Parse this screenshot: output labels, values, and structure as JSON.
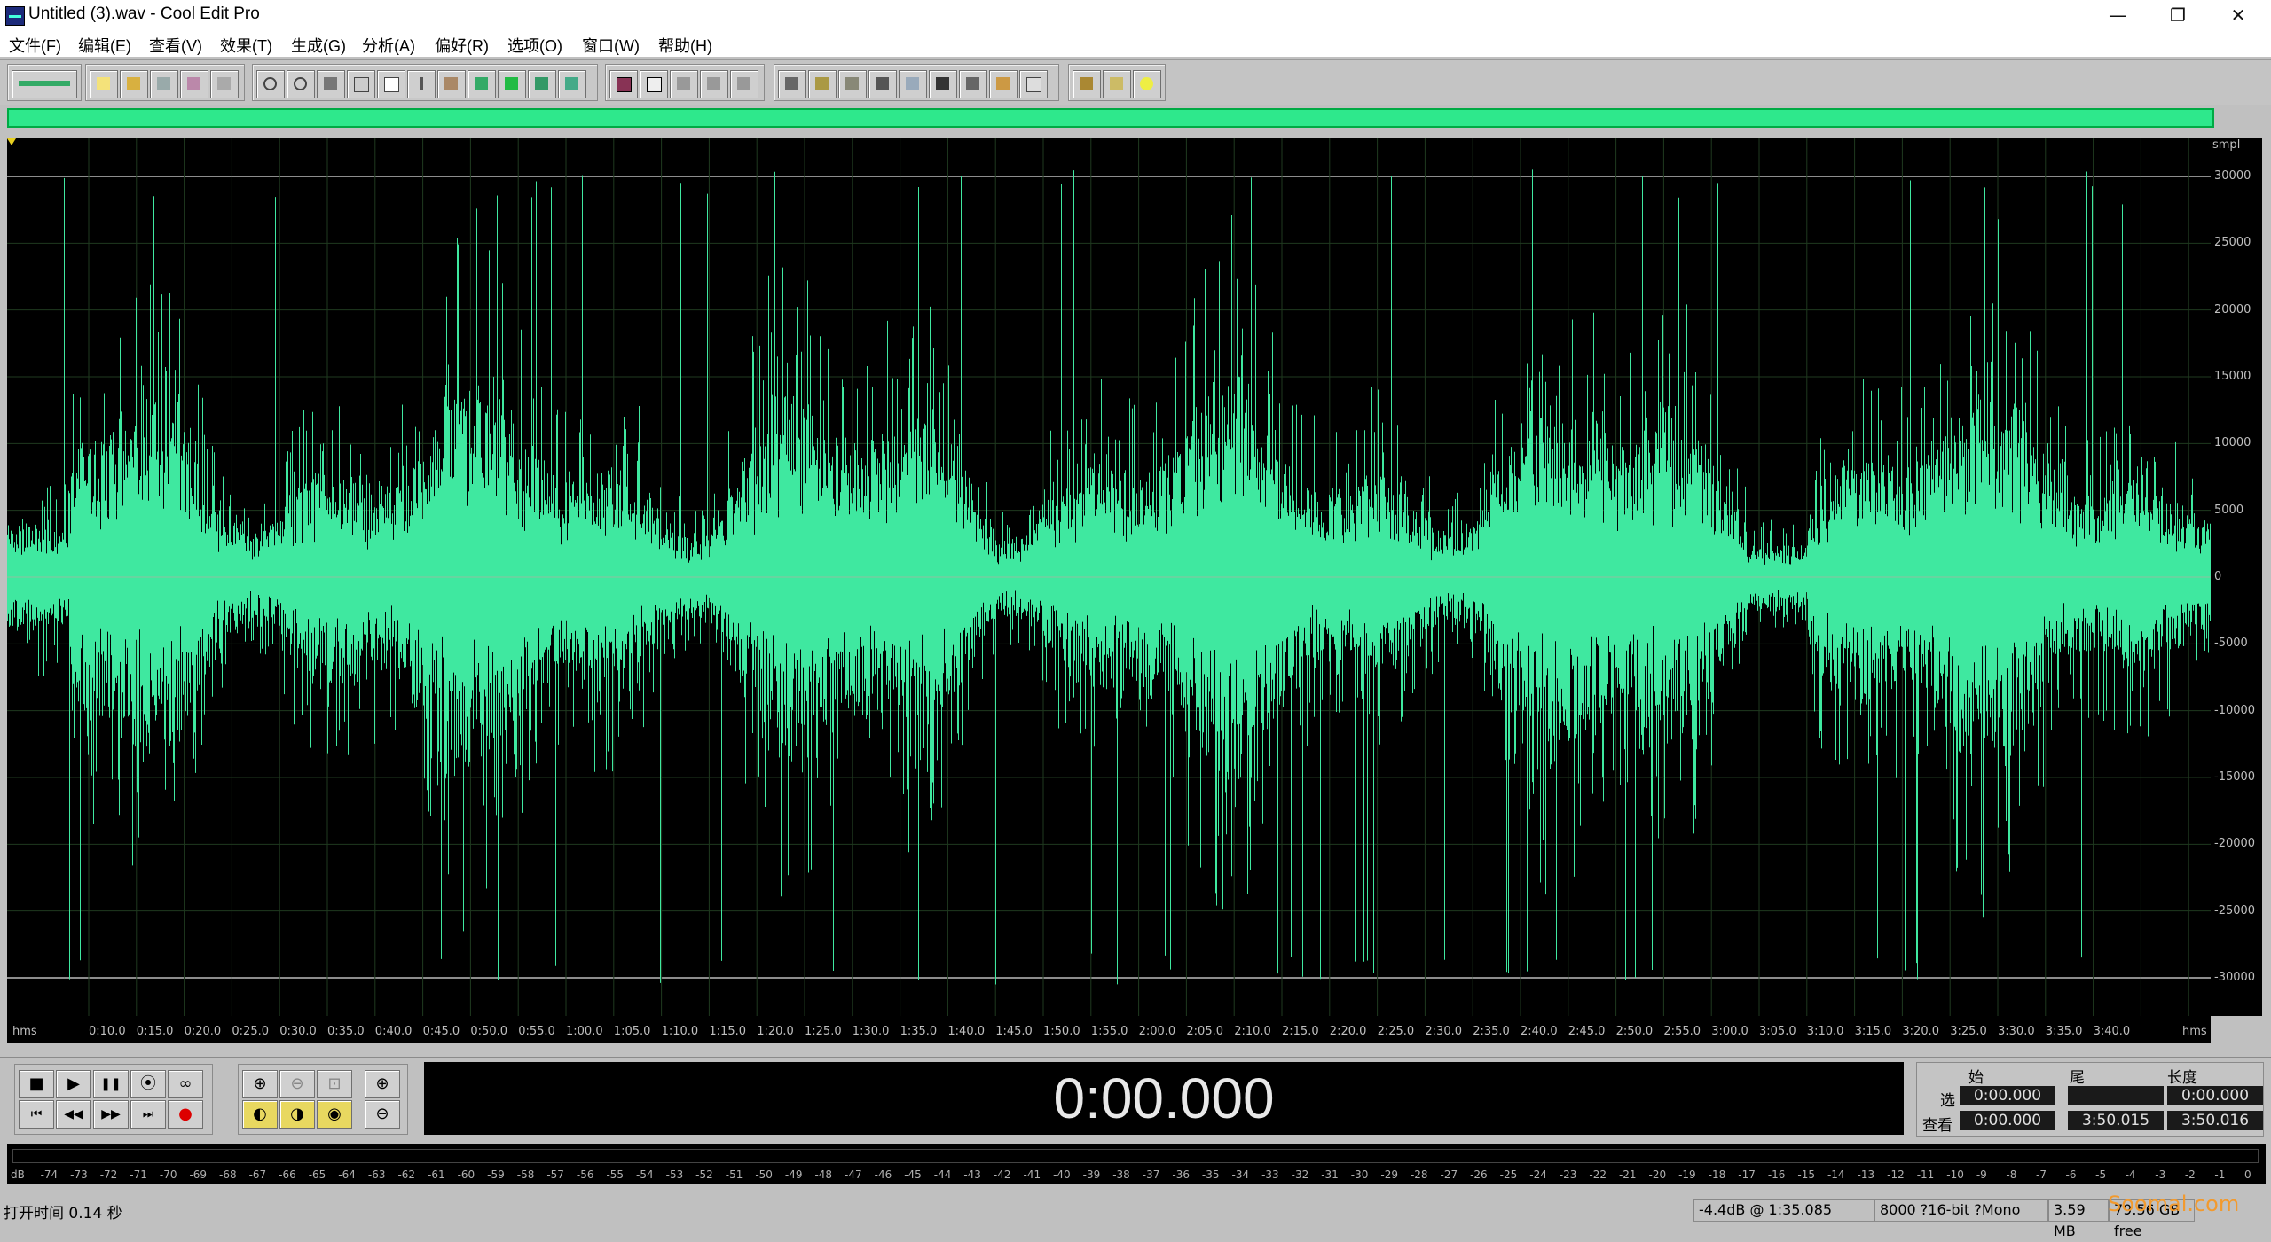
{
  "window": {
    "title": "Untitled (3).wav - Cool Edit Pro",
    "minimize": "—",
    "restore": "❐",
    "close": "✕"
  },
  "menu": [
    "文件(F)",
    "编辑(E)",
    "查看(V)",
    "效果(T)",
    "生成(G)",
    "分析(A)",
    "偏好(R)",
    "选项(O)",
    "窗口(W)",
    "帮助(H)"
  ],
  "colors": {
    "waveform": "#3fe8a0",
    "background": "#000000",
    "overview": "#2ee88c"
  },
  "waveform": {
    "y_unit": "smpl",
    "y_ticks": [
      "30000",
      "25000",
      "20000",
      "15000",
      "10000",
      "5000",
      "0",
      "-5000",
      "-10000",
      "-15000",
      "-20000",
      "-25000",
      "-30000"
    ],
    "x_unit": "hms",
    "x_ticks": [
      "0:10.0",
      "0:15.0",
      "0:20.0",
      "0:25.0",
      "0:30.0",
      "0:35.0",
      "0:40.0",
      "0:45.0",
      "0:50.0",
      "0:55.0",
      "1:00.0",
      "1:05.0",
      "1:10.0",
      "1:15.0",
      "1:20.0",
      "1:25.0",
      "1:30.0",
      "1:35.0",
      "1:40.0",
      "1:45.0",
      "1:50.0",
      "1:55.0",
      "2:00.0",
      "2:05.0",
      "2:10.0",
      "2:15.0",
      "2:20.0",
      "2:25.0",
      "2:30.0",
      "2:35.0",
      "2:40.0",
      "2:45.0",
      "2:50.0",
      "2:55.0",
      "3:00.0",
      "3:05.0",
      "3:10.0",
      "3:15.0",
      "3:20.0",
      "3:25.0",
      "3:30.0",
      "3:35.0",
      "3:40.0"
    ]
  },
  "transport": {
    "stop": "■",
    "play": "▶",
    "pause": "❚❚",
    "play_from_cursor": "⦿",
    "loop": "∞",
    "go_start": "⏮",
    "rewind": "◀◀",
    "fast_forward": "▶▶",
    "go_end": "⏭",
    "record": "●"
  },
  "clock": "0:00.000",
  "selection": {
    "col_begin": "始",
    "col_end": "尾",
    "col_length": "长度",
    "row_sel": "选",
    "row_view": "查看",
    "sel_begin": "0:00.000",
    "sel_end": "",
    "sel_length": "0:00.000",
    "view_begin": "0:00.000",
    "view_end": "3:50.015",
    "view_length": "3:50.016"
  },
  "meter_ticks": [
    "dB",
    "-74",
    "-73",
    "-72",
    "-71",
    "-70",
    "-69",
    "-68",
    "-67",
    "-66",
    "-65",
    "-64",
    "-63",
    "-62",
    "-61",
    "-60",
    "-59",
    "-58",
    "-57",
    "-56",
    "-55",
    "-54",
    "-53",
    "-52",
    "-51",
    "-50",
    "-49",
    "-48",
    "-47",
    "-46",
    "-45",
    "-44",
    "-43",
    "-42",
    "-41",
    "-40",
    "-39",
    "-38",
    "-37",
    "-36",
    "-35",
    "-34",
    "-33",
    "-32",
    "-31",
    "-30",
    "-29",
    "-28",
    "-27",
    "-26",
    "-25",
    "-24",
    "-23",
    "-22",
    "-21",
    "-20",
    "-19",
    "-18",
    "-17",
    "-16",
    "-15",
    "-14",
    "-13",
    "-12",
    "-11",
    "-10",
    "-9",
    "-8",
    "-7",
    "-6",
    "-5",
    "-4",
    "-3",
    "-2",
    "-1",
    "0"
  ],
  "status": {
    "open_time": "打开时间  0.14 秒",
    "level": "-4.4dB @   1:35.085",
    "format": "8000 ?16-bit ?Mono",
    "size": "3.59 MB",
    "free": "79.56 GB free",
    "watermark": "Soomal.com"
  }
}
